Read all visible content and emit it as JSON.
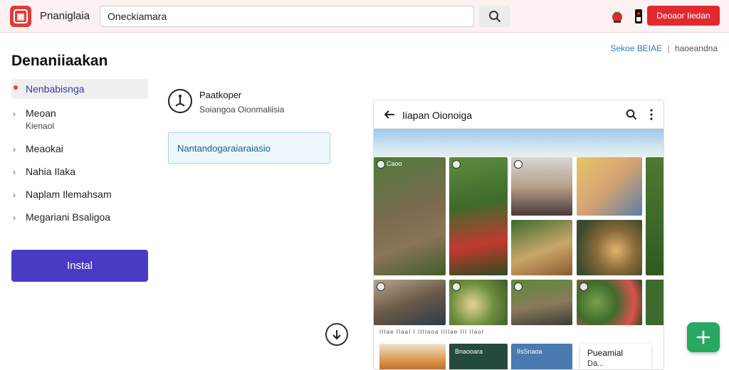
{
  "header": {
    "app_title": "Pnaniglaia",
    "logo_mark": "▣",
    "search": {
      "value": "Oneckiamara",
      "placeholder": ""
    },
    "primary_button": "Deoaor Iiedan"
  },
  "page": {
    "title": "Denaniiaakan",
    "top_right_link": "Sekoe BEIAE",
    "top_right_separator": "|",
    "top_right_muted": "haoeandna"
  },
  "sidebar": {
    "items": [
      {
        "label": "Nenbabisnga",
        "sub": "",
        "active": true
      },
      {
        "label": "Meoan",
        "sub": "Kienaol",
        "active": false
      },
      {
        "label": "Meaokai",
        "sub": "",
        "active": false
      },
      {
        "label": "Nahia Ilaka",
        "sub": "",
        "active": false
      },
      {
        "label": "Naplam Ilemahsam",
        "sub": "",
        "active": false
      },
      {
        "label": "Megariani Bsaligoa",
        "sub": "",
        "active": false
      }
    ],
    "install_label": "Instal"
  },
  "profile": {
    "name": "Paatkoper",
    "subtitle": "Soiangoa Oionmaliisia"
  },
  "notice": {
    "text": "Nantandogaraiaraiasio"
  },
  "phone": {
    "title": "Iiapan Oionoiga",
    "tile_badge_text": "Caoo",
    "strip_text": "IIIae IIaaI I IIIIaoa IIIIae III IIaoI",
    "tile_row3_labels": [
      "Bnaooara",
      "IIsSnaoa"
    ],
    "card_title": "Pueamial",
    "card_sub": "Da..."
  },
  "colors": {
    "brand_red": "#e1292f",
    "install_purple": "#4a3bc4",
    "fab_green": "#27a861",
    "link_blue": "#2a7db8"
  },
  "icons": {
    "logo": "logo-icon",
    "search": "search-icon",
    "notifications": "tomato-icon",
    "device": "speaker-icon",
    "back": "arrow-left-icon",
    "more": "more-vertical-icon",
    "down": "arrow-down-icon",
    "add": "plus-icon"
  }
}
